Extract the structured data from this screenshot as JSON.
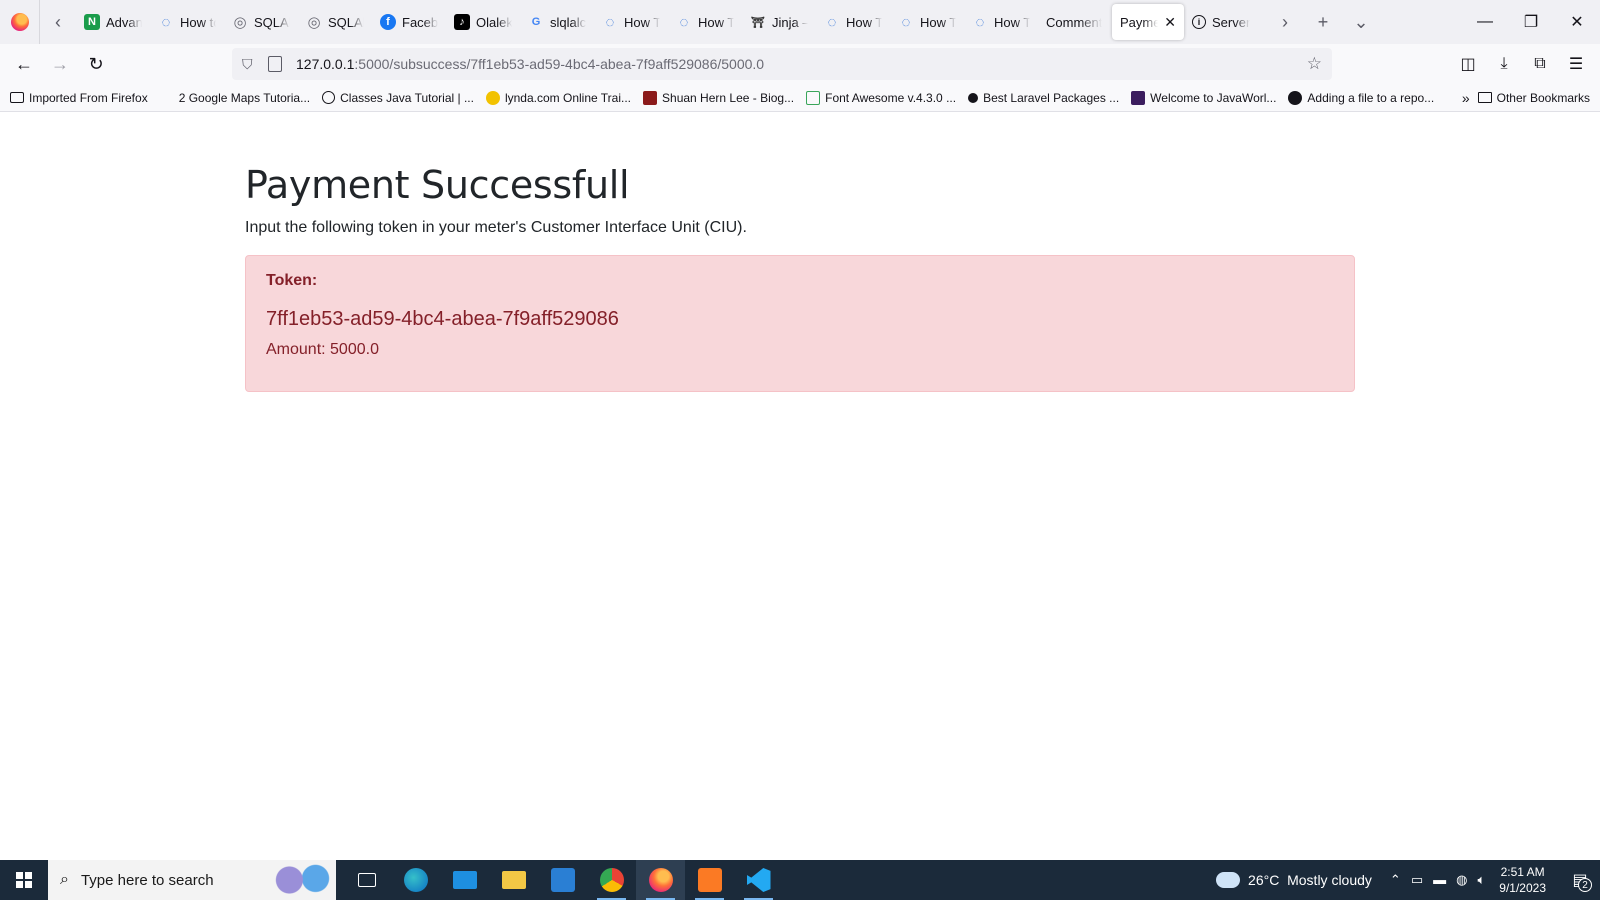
{
  "browser": {
    "tabs": [
      {
        "title": "Advanced",
        "favicon": "n-icon",
        "fav_color": "#1a9c4b",
        "fav_glyph": "N"
      },
      {
        "title": "How to",
        "favicon": "sync-icon",
        "fav_color": "#2b6fd6",
        "fav_glyph": "◌"
      },
      {
        "title": "SQLAlchemy",
        "favicon": "sqlalchemy-icon",
        "fav_color": "#8a8a8a",
        "fav_glyph": "◎"
      },
      {
        "title": "SQLAlchemy",
        "favicon": "sqlalchemy-icon",
        "fav_color": "#8a8a8a",
        "fav_glyph": "◎"
      },
      {
        "title": "Facebook",
        "favicon": "facebook-icon",
        "fav_color": "#1877f2",
        "fav_glyph": "f"
      },
      {
        "title": "Olalekan",
        "favicon": "tiktok-icon",
        "fav_color": "#000000",
        "fav_glyph": "♪"
      },
      {
        "title": "slqlalchemy",
        "favicon": "google-icon",
        "fav_color": "#ffffff",
        "fav_glyph": "G"
      },
      {
        "title": "How To",
        "favicon": "sync-icon",
        "fav_color": "#2b6fd6",
        "fav_glyph": "◌"
      },
      {
        "title": "How To",
        "favicon": "sync-icon",
        "fav_color": "#2b6fd6",
        "fav_glyph": "◌"
      },
      {
        "title": "Jinja —",
        "favicon": "jinja-icon",
        "fav_color": "#555555",
        "fav_glyph": "⛩"
      },
      {
        "title": "How To",
        "favicon": "sync-icon",
        "fav_color": "#2b6fd6",
        "fav_glyph": "◌"
      },
      {
        "title": "How To",
        "favicon": "sync-icon",
        "fav_color": "#2b6fd6",
        "fav_glyph": "◌"
      },
      {
        "title": "How To",
        "favicon": "sync-icon",
        "fav_color": "#2b6fd6",
        "fav_glyph": "◌"
      },
      {
        "title": "Comment",
        "favicon": "",
        "fav_color": "",
        "fav_glyph": ""
      }
    ],
    "active_tab": {
      "title": "Payment Successfull",
      "close": "✕"
    },
    "after_tab": {
      "title": "Server",
      "favicon": "info-icon"
    },
    "url": {
      "host": "127.0.0.1",
      "path": ":5000/subsuccess/7ff1eb53-ad59-4bc4-abea-7f9aff529086/5000.0"
    }
  },
  "bookmarks": [
    {
      "label": "Imported From Firefox",
      "icon": "folder-icon"
    },
    {
      "label": "2 Google Maps Tutoria...",
      "icon": "people-icon"
    },
    {
      "label": "Classes Java Tutorial | ...",
      "icon": "globe-icon"
    },
    {
      "label": "lynda.com Online Trai...",
      "icon": "lynda-icon"
    },
    {
      "label": "Shuan Hern Lee - Biog...",
      "icon": "portrait-icon"
    },
    {
      "label": "Font Awesome v.4.3.0 ...",
      "icon": "font-awesome-icon"
    },
    {
      "label": "Best Laravel Packages ...",
      "icon": "laravel-icon"
    },
    {
      "label": "Welcome to JavaWorl...",
      "icon": "javaworld-icon"
    },
    {
      "label": "Adding a file to a repo...",
      "icon": "github-icon"
    }
  ],
  "other_bookmarks": "Other Bookmarks",
  "page": {
    "title": "Payment Successfull",
    "lead": "Input the following token in your meter's Customer Interface Unit (CIU).",
    "token_label": "Token:",
    "token_value": "7ff1eb53-ad59-4bc4-abea-7f9aff529086",
    "amount": "Amount: 5000.0"
  },
  "taskbar": {
    "search_placeholder": "Type here to search",
    "weather": "26°C  Mostly cloudy",
    "time": "2:51 AM",
    "date": "9/1/2023",
    "notifications": "2"
  }
}
